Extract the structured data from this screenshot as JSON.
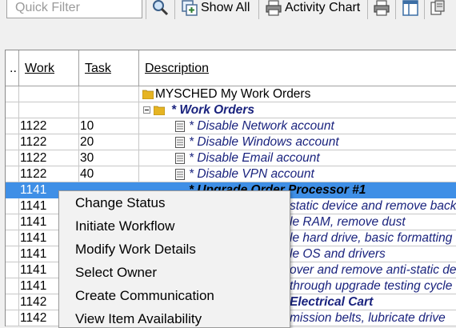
{
  "toolbar": {
    "filter_placeholder": "Quick Filter",
    "show_all_label": "Show All",
    "activity_chart_label": "Activity Chart"
  },
  "grid": {
    "columns": [
      "..",
      "Work",
      "Task",
      "Description"
    ],
    "tree": {
      "root_label": "MYSCHED  My Work Orders",
      "group_label": "* Work Orders"
    },
    "rows": [
      {
        "work": "1122",
        "task": "10",
        "desc": "* Disable Network account"
      },
      {
        "work": "1122",
        "task": "20",
        "desc": "* Disable Windows account"
      },
      {
        "work": "1122",
        "task": "30",
        "desc": "* Disable Email account"
      },
      {
        "work": "1122",
        "task": "40",
        "desc": "* Disable VPN account"
      },
      {
        "work": "1141",
        "task": "",
        "desc": "* Upgrade Order Processor #1"
      },
      {
        "work": "1141",
        "task": "",
        "desc": "static device and remove back"
      },
      {
        "work": "1141",
        "task": "",
        "desc": "le RAM, remove dust"
      },
      {
        "work": "1141",
        "task": "",
        "desc": "le hard drive, basic formatting"
      },
      {
        "work": "1141",
        "task": "",
        "desc": "le OS and drivers"
      },
      {
        "work": "1141",
        "task": "",
        "desc": "over and remove anti-static de"
      },
      {
        "work": "1141",
        "task": "",
        "desc": "through upgrade testing cycle"
      },
      {
        "work": "1142",
        "task": "",
        "desc": "Electrical Cart"
      },
      {
        "work": "1142",
        "task": "",
        "desc": "mission belts, lubricate drive"
      }
    ]
  },
  "context_menu": {
    "items": [
      "Change Status",
      "Initiate Workflow",
      "Modify Work Details",
      "Select Owner",
      "Create Communication",
      "View Item Availability"
    ]
  },
  "colors": {
    "selection": "#3f8fe6",
    "work_order_text": "#1a237e"
  }
}
